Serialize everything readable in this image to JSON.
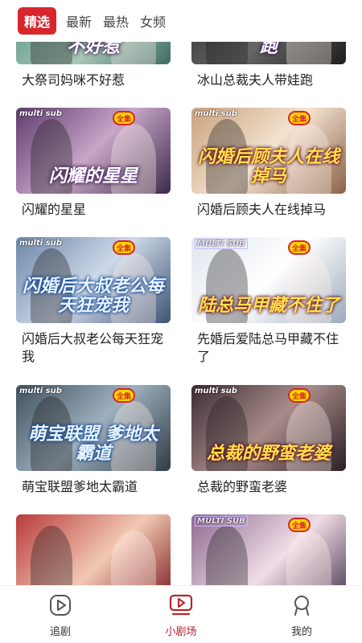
{
  "tabs": [
    {
      "label": "精选",
      "active": true
    },
    {
      "label": "最新",
      "active": false
    },
    {
      "label": "最热",
      "active": false
    },
    {
      "label": "女频",
      "active": false
    }
  ],
  "dramas": [
    {
      "title": "大祭司妈咪不好惹",
      "poster_text": "不好惹",
      "tag": "",
      "badge": "",
      "theme": "teal"
    },
    {
      "title": "冰山总裁夫人带娃跑",
      "poster_text": "冰山总裁夫人带娃跑",
      "tag": "",
      "badge": "",
      "theme": "dark"
    },
    {
      "title": "闪耀的星星",
      "poster_text": "闪耀的星星",
      "tag": "multi sub",
      "badge": "全集",
      "theme": "purple"
    },
    {
      "title": "闪婚后顾夫人在线掉马",
      "poster_text": "闪婚后顾夫人在线掉马",
      "tag": "multi sub",
      "badge": "全集",
      "theme": "warm"
    },
    {
      "title": "闪婚后大叔老公每天狂宠我",
      "poster_text": "闪婚后大叔老公每天狂宠我",
      "tag": "multi sub",
      "badge": "全集",
      "theme": "blue"
    },
    {
      "title": "先婚后爱陆总马甲藏不住了",
      "poster_text": "陆总马甲藏不住了",
      "tag": "MULTI SUB",
      "badge": "全集",
      "theme": "light"
    },
    {
      "title": "萌宝联盟爹地太霸道",
      "poster_text": "萌宝联盟 爹地太霸道",
      "tag": "multi sub",
      "badge": "全集",
      "theme": "grey"
    },
    {
      "title": "总裁的野蛮老婆",
      "poster_text": "总裁的野蛮老婆",
      "tag": "multi sub",
      "badge": "全集",
      "theme": "dusk"
    },
    {
      "title": "",
      "poster_text": "",
      "tag": "",
      "badge": "",
      "theme": "red"
    },
    {
      "title": "",
      "poster_text": "",
      "tag": "MULTI SUB",
      "badge": "全集",
      "theme": "pink"
    }
  ],
  "nav": [
    {
      "label": "追剧",
      "icon": "play-circle-icon",
      "active": false
    },
    {
      "label": "小剧场",
      "icon": "video-play-icon",
      "active": true
    },
    {
      "label": "我的",
      "icon": "user-icon",
      "active": false
    }
  ],
  "colors": {
    "accent": "#d7262c",
    "nav_active": "#b3262b"
  }
}
